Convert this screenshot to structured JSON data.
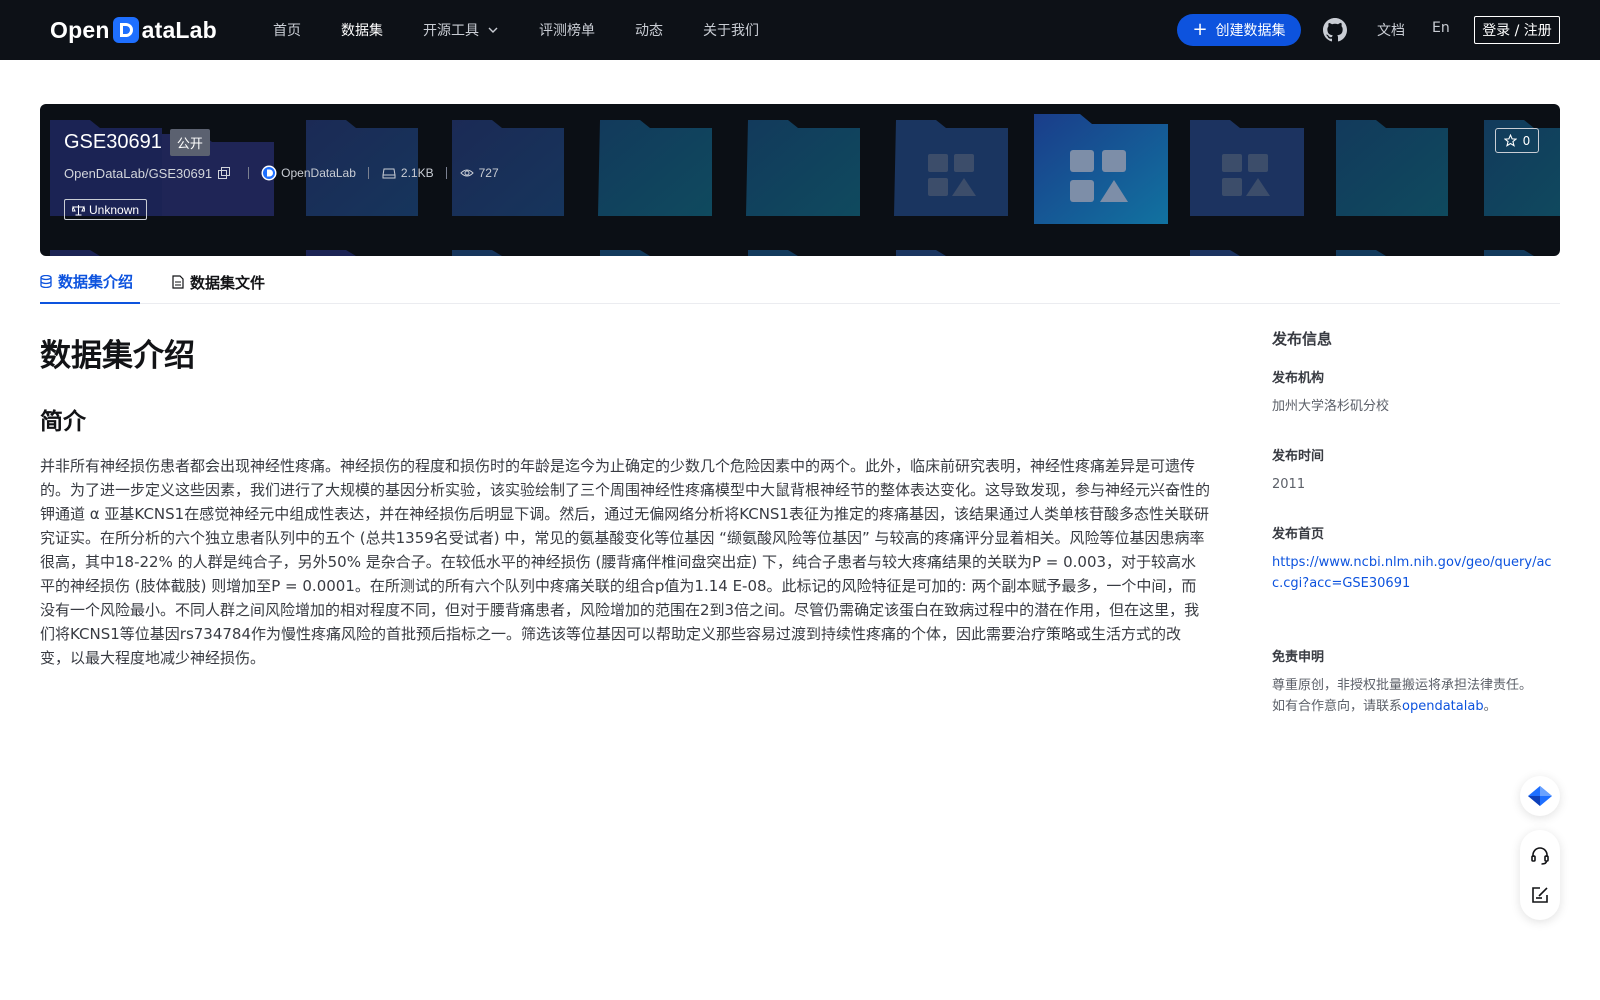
{
  "header": {
    "logo_text_left": "Open",
    "logo_text_right": "ataLab",
    "nav": [
      {
        "label": "首页",
        "active": false
      },
      {
        "label": "数据集",
        "active": true
      },
      {
        "label": "开源工具",
        "active": false,
        "dropdown": true
      },
      {
        "label": "评测榜单",
        "active": false
      },
      {
        "label": "动态",
        "active": false
      },
      {
        "label": "关于我们",
        "active": false
      }
    ],
    "create_button": "创建数据集",
    "docs": "文档",
    "lang": "En",
    "login": "登录 / 注册"
  },
  "dataset": {
    "name": "GSE30691",
    "visibility": "公开",
    "path": "OpenDataLab/GSE30691",
    "publisher": "OpenDataLab",
    "size": "2.1KB",
    "views": "727",
    "license": "Unknown",
    "stars": "0"
  },
  "tabs": [
    {
      "label": "数据集介绍",
      "active": true
    },
    {
      "label": "数据集文件",
      "active": false
    }
  ],
  "main": {
    "title": "数据集介绍",
    "section": "简介",
    "description": "并非所有神经损伤患者都会出现神经性疼痛。神经损伤的程度和损伤时的年龄是迄今为止确定的少数几个危险因素中的两个。此外，临床前研究表明，神经性疼痛差异是可遗传的。为了进一步定义这些因素，我们进行了大规模的基因分析实验，该实验绘制了三个周围神经性疼痛模型中大鼠背根神经节的整体表达变化。这导致发现，参与神经元兴奋性的钾通道 α 亚基KCNS1在感觉神经元中组成性表达，并在神经损伤后明显下调。然后，通过无偏网络分析将KCNS1表征为推定的疼痛基因，该结果通过人类单核苷酸多态性关联研究证实。在所分析的六个独立患者队列中的五个 (总共1359名受试者) 中，常见的氨基酸变化等位基因 “缬氨酸风险等位基因” 与较高的疼痛评分显着相关。风险等位基因患病率很高，其中18-22% 的人群是纯合子，另外50% 是杂合子。在较低水平的神经损伤 (腰背痛伴椎间盘突出症) 下，纯合子患者与较大疼痛结果的关联为P = 0.003，对于较高水平的神经损伤 (肢体截肢) 则增加至P = 0.0001。在所测试的所有六个队列中疼痛关联的组合p值为1.14 E-08。此标记的风险特征是可加的: 两个副本赋予最多，一个中间，而没有一个风险最小。不同人群之间风险增加的相对程度不同，但对于腰背痛患者，风险增加的范围在2到3倍之间。尽管仍需确定该蛋白在致病过程中的潜在作用，但在这里，我们将KCNS1等位基因rs734784作为慢性疼痛风险的首批预后指标之一。筛选该等位基因可以帮助定义那些容易过渡到持续性疼痛的个体，因此需要治疗策略或生活方式的改变，以最大程度地减少神经损伤。"
  },
  "side": {
    "title": "发布信息",
    "org_label": "发布机构",
    "org": "加州大学洛杉矶分校",
    "time_label": "发布时间",
    "time": "2011",
    "home_label": "发布首页",
    "home_url": "https://www.ncbi.nlm.nih.gov/geo/query/acc.cgi?acc=GSE30691",
    "disclaimer_label": "免责申明",
    "disclaimer_1": "尊重原创，非授权批量搬运将承担法律责任。",
    "disclaimer_2_prefix": "如有合作意向，请联系",
    "disclaimer_link": "opendatalab",
    "disclaimer_2_suffix": "。"
  },
  "colors": {
    "topbar": "#0d1117",
    "accent": "#0d53de",
    "banner_bg": "#0b0f15"
  }
}
